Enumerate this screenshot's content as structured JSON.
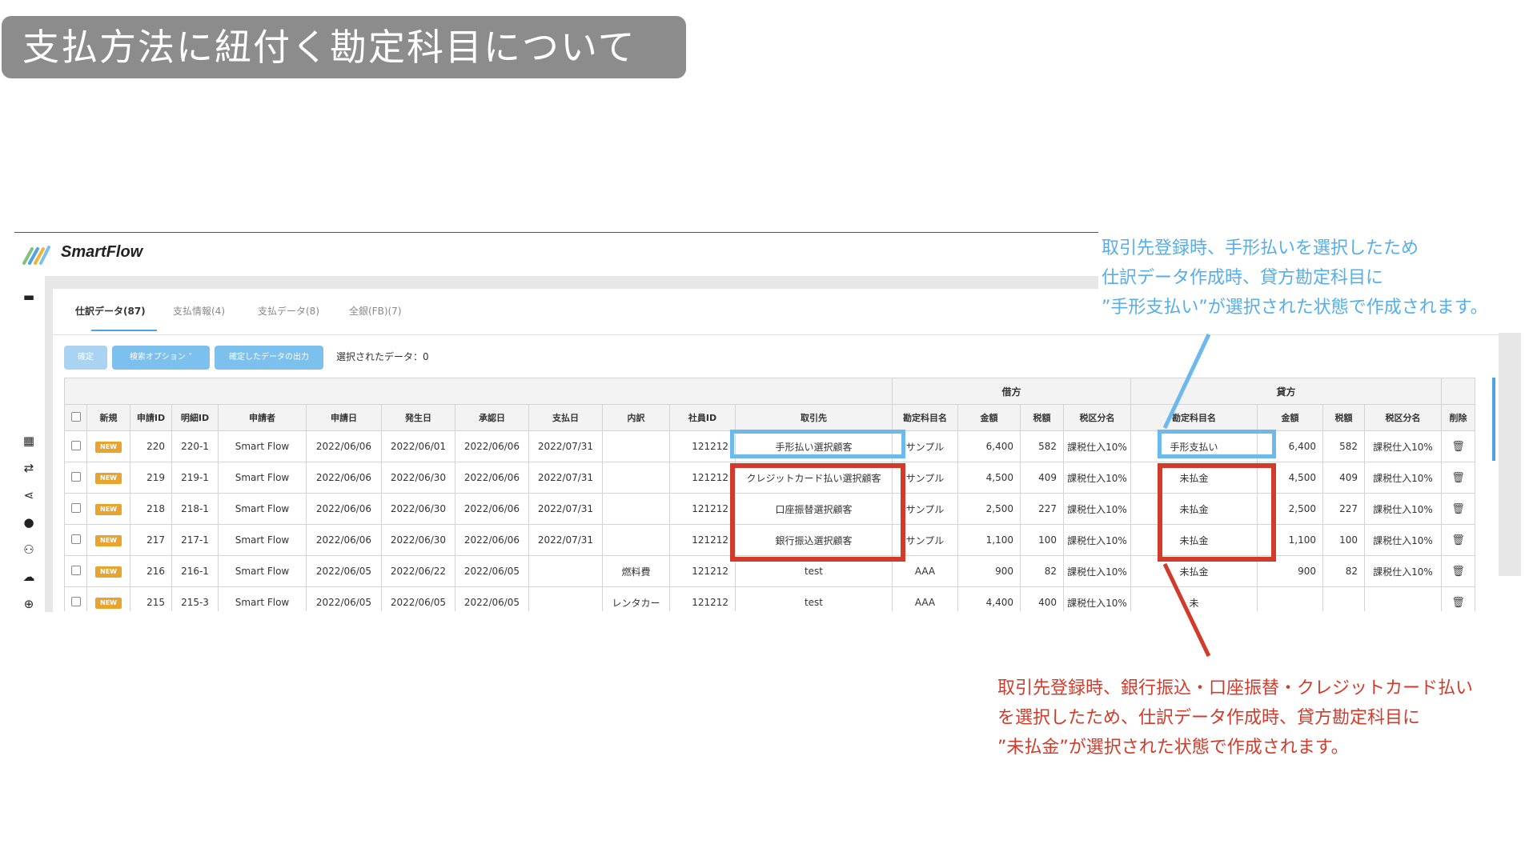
{
  "title": "支払方法に紐付く勘定科目について",
  "app": {
    "brand": "SmartFlow"
  },
  "sidebar": {
    "icons": [
      "wallet-icon",
      "grid-icon",
      "flow-icon",
      "share-icon",
      "user-icon",
      "users-icon",
      "cloud-upload-icon",
      "globe-icon"
    ]
  },
  "tabs": [
    {
      "label": "仕訳データ(87)",
      "active": true
    },
    {
      "label": "支払情報(4)",
      "active": false
    },
    {
      "label": "支払データ(8)",
      "active": false
    },
    {
      "label": "全銀(FB)(7)",
      "active": false
    }
  ],
  "toolbar": {
    "confirm_label": "確定",
    "search_options_label": "検索オプション ˅",
    "export_label": "確定したデータの出力",
    "selected_label": "選択されたデータ：0"
  },
  "table": {
    "group_headers": {
      "debit": "借方",
      "credit": "貸方"
    },
    "columns": [
      "",
      "新規",
      "申請ID",
      "明細ID",
      "申請者",
      "申請日",
      "発生日",
      "承認日",
      "支払日",
      "内訳",
      "社員ID",
      "取引先",
      "勘定科目名",
      "金額",
      "税額",
      "税区分名",
      "勘定科目名",
      "金額",
      "税額",
      "税区分名",
      "削除"
    ],
    "badge_label": "NEW",
    "rows": [
      {
        "id": "220",
        "detail": "220-1",
        "applicant": "Smart Flow",
        "applied": "2022/06/06",
        "occurred": "2022/06/01",
        "approved": "2022/06/06",
        "paid": "2022/07/31",
        "breakdown": "",
        "employee": "121212",
        "vendor": "手形払い選択顧客",
        "dr_account": "サンプル",
        "dr_amount": "6,400",
        "dr_tax": "582",
        "dr_taxclass": "課税仕入10%",
        "cr_account": "手形支払い",
        "cr_amount": "6,400",
        "cr_tax": "582",
        "cr_taxclass": "課税仕入10%"
      },
      {
        "id": "219",
        "detail": "219-1",
        "applicant": "Smart Flow",
        "applied": "2022/06/06",
        "occurred": "2022/06/30",
        "approved": "2022/06/06",
        "paid": "2022/07/31",
        "breakdown": "",
        "employee": "121212",
        "vendor": "クレジットカード払い選択顧客",
        "dr_account": "サンプル",
        "dr_amount": "4,500",
        "dr_tax": "409",
        "dr_taxclass": "課税仕入10%",
        "cr_account": "未払金",
        "cr_amount": "4,500",
        "cr_tax": "409",
        "cr_taxclass": "課税仕入10%"
      },
      {
        "id": "218",
        "detail": "218-1",
        "applicant": "Smart Flow",
        "applied": "2022/06/06",
        "occurred": "2022/06/30",
        "approved": "2022/06/06",
        "paid": "2022/07/31",
        "breakdown": "",
        "employee": "121212",
        "vendor": "口座振替選択顧客",
        "dr_account": "サンプル",
        "dr_amount": "2,500",
        "dr_tax": "227",
        "dr_taxclass": "課税仕入10%",
        "cr_account": "未払金",
        "cr_amount": "2,500",
        "cr_tax": "227",
        "cr_taxclass": "課税仕入10%"
      },
      {
        "id": "217",
        "detail": "217-1",
        "applicant": "Smart Flow",
        "applied": "2022/06/06",
        "occurred": "2022/06/30",
        "approved": "2022/06/06",
        "paid": "2022/07/31",
        "breakdown": "",
        "employee": "121212",
        "vendor": "銀行振込選択顧客",
        "dr_account": "サンプル",
        "dr_amount": "1,100",
        "dr_tax": "100",
        "dr_taxclass": "課税仕入10%",
        "cr_account": "未払金",
        "cr_amount": "1,100",
        "cr_tax": "100",
        "cr_taxclass": "課税仕入10%"
      },
      {
        "id": "216",
        "detail": "216-1",
        "applicant": "Smart Flow",
        "applied": "2022/06/05",
        "occurred": "2022/06/22",
        "approved": "2022/06/05",
        "paid": "",
        "breakdown": "燃料費",
        "employee": "121212",
        "vendor": "test",
        "dr_account": "AAA",
        "dr_amount": "900",
        "dr_tax": "82",
        "dr_taxclass": "課税仕入10%",
        "cr_account": "未払金",
        "cr_amount": "900",
        "cr_tax": "82",
        "cr_taxclass": "課税仕入10%"
      },
      {
        "id": "215",
        "detail": "215-3",
        "applicant": "Smart Flow",
        "applied": "2022/06/05",
        "occurred": "2022/06/05",
        "approved": "2022/06/05",
        "paid": "",
        "breakdown": "レンタカー",
        "employee": "121212",
        "vendor": "test",
        "dr_account": "AAA",
        "dr_amount": "4,400",
        "dr_tax": "400",
        "dr_taxclass": "課税仕入10%",
        "cr_account": "未",
        "cr_amount": "",
        "cr_tax": "",
        "cr_taxclass": ""
      }
    ]
  },
  "callouts": {
    "blue": [
      "取引先登録時、手形払いを選択したため",
      "仕訳データ作成時、貸方勘定科目に",
      "”手形支払い”が選択された状態で作成されます。"
    ],
    "red": [
      "取引先登録時、銀行振込・口座振替・クレジットカード払い",
      "を選択したため、仕訳データ作成時、貸方勘定科目に",
      "”未払金”が選択された状態で作成されます。"
    ]
  },
  "colors": {
    "blue_annotation": "#6cb9ee",
    "red_annotation": "#d23b2a",
    "title_banner": "#8c8c8c",
    "badge": "#e8a42c",
    "button": "#7cc0ee"
  }
}
